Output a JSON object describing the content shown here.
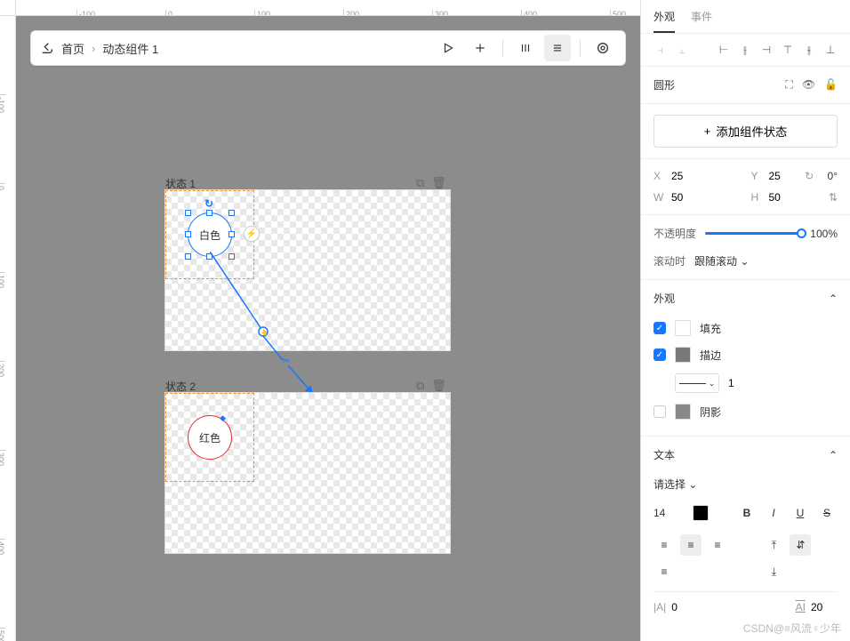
{
  "breadcrumb": {
    "home": "首页",
    "current": "动态组件 1"
  },
  "ruler_h": [
    "-100",
    "0",
    "100",
    "200",
    "300",
    "400",
    "500"
  ],
  "ruler_v": [
    "-100",
    "0",
    "100",
    "200",
    "300",
    "400",
    "500"
  ],
  "states": [
    {
      "label": "状态 1",
      "circle_text": "白色"
    },
    {
      "label": "状态 2",
      "circle_text": "红色"
    }
  ],
  "tabs": {
    "appearance": "外观",
    "events": "事件"
  },
  "shape": {
    "title": "圆形"
  },
  "add_state": "添加组件状态",
  "geom": {
    "x_label": "X",
    "x": "25",
    "y_label": "Y",
    "y": "25",
    "w_label": "W",
    "w": "50",
    "h_label": "H",
    "h": "50",
    "rot": "0°"
  },
  "opacity": {
    "label": "不透明度",
    "value": "100%",
    "percent": 100
  },
  "scroll": {
    "label": "滚动时",
    "value": "跟随滚动"
  },
  "appearance_section": {
    "title": "外观",
    "fill": "填充",
    "stroke": "描边",
    "stroke_width": "1",
    "shadow": "阴影"
  },
  "text_section": {
    "title": "文本",
    "select_placeholder": "请选择",
    "font_size": "14",
    "letter_spacing_label": "|A|",
    "letter_spacing": "0",
    "line_height_label": "AI",
    "line_height": "20"
  },
  "watermark": "CSDN@≡风流♀少年"
}
